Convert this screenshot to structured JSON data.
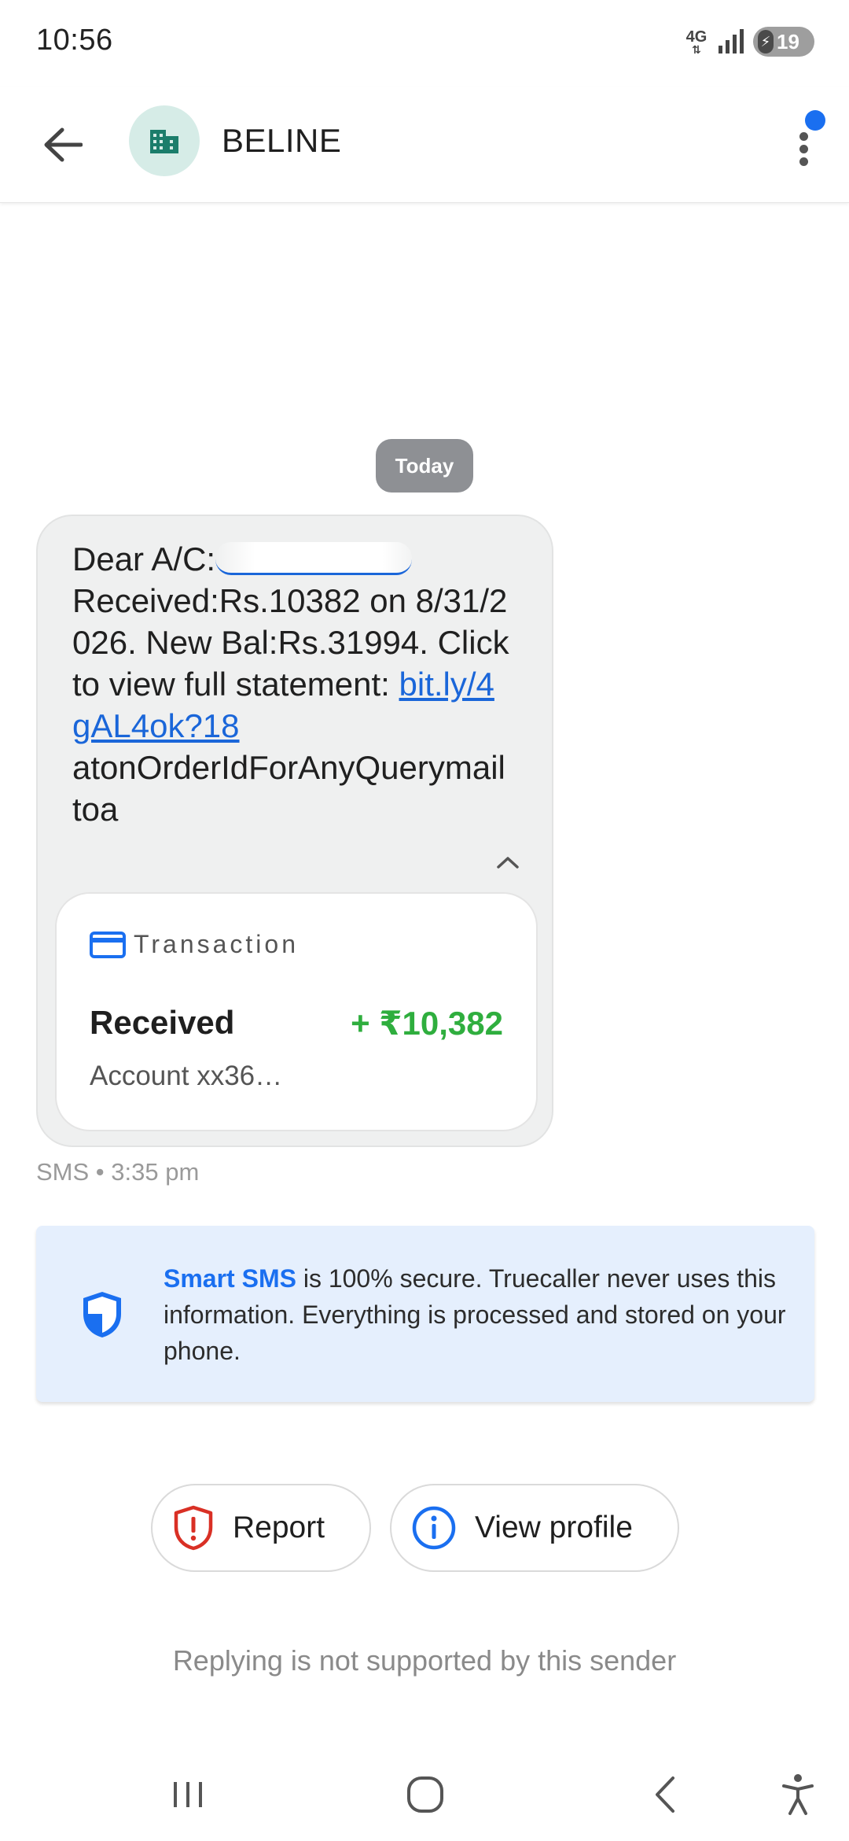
{
  "status_bar": {
    "time": "10:56",
    "network_type": "4G",
    "battery_level": "19"
  },
  "header": {
    "sender_name": "BELINE",
    "avatar_icon": "business-building-icon",
    "has_notification": true
  },
  "thread": {
    "date_chip": "Today",
    "message": {
      "prefix": "Dear A/C:",
      "body": "Received:Rs.10382 on 8/31/2026. New Bal:Rs.31994. Click to view full statement: ",
      "link_text": "bit.ly/4gAL4ok?18",
      "suffix": "atonOrderIdForAnyQuerymailtoa"
    },
    "transaction_card": {
      "header_label": "Transaction",
      "title": "Received",
      "amount": "+ ₹10,382",
      "account": "Account xx36…"
    },
    "meta": "SMS • 3:35 pm"
  },
  "info_banner": {
    "highlight": "Smart SMS",
    "text": " is 100% secure. Truecaller never uses this information. Everything is processed and stored on your phone."
  },
  "actions": {
    "report_label": "Report",
    "view_profile_label": "View profile"
  },
  "reply_note": "Replying is not supported by this sender",
  "colors": {
    "accent_blue": "#1a6ff0",
    "amount_green": "#2fae3e",
    "report_red": "#d93025",
    "bubble_bg": "#eff0f0",
    "banner_bg": "#e5effd"
  }
}
